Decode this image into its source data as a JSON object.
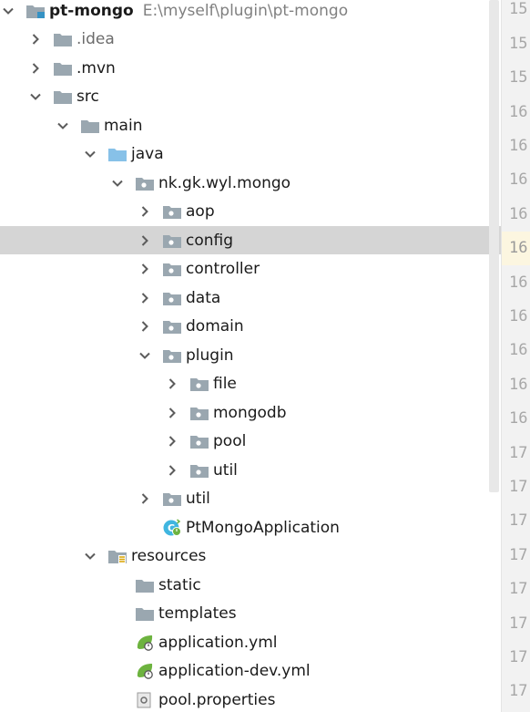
{
  "project": {
    "name": "pt-mongo",
    "path": "E:\\myself\\plugin\\pt-mongo"
  },
  "tree": [
    {
      "label": "pt-mongo",
      "depth": 0,
      "state": "open",
      "icon": "module-folder-icon",
      "bold": true
    },
    {
      "label": ".idea",
      "depth": 1,
      "state": "closed",
      "icon": "folder-icon",
      "dim": true
    },
    {
      "label": ".mvn",
      "depth": 1,
      "state": "closed",
      "icon": "folder-icon"
    },
    {
      "label": "src",
      "depth": 1,
      "state": "open",
      "icon": "folder-icon"
    },
    {
      "label": "main",
      "depth": 2,
      "state": "open",
      "icon": "folder-icon"
    },
    {
      "label": "java",
      "depth": 3,
      "state": "open",
      "icon": "source-root-folder-icon"
    },
    {
      "label": "nk.gk.wyl.mongo",
      "depth": 4,
      "state": "open",
      "icon": "package-icon"
    },
    {
      "label": "aop",
      "depth": 5,
      "state": "closed",
      "icon": "package-icon"
    },
    {
      "label": "config",
      "depth": 5,
      "state": "closed",
      "icon": "package-icon",
      "selected": true
    },
    {
      "label": "controller",
      "depth": 5,
      "state": "closed",
      "icon": "package-icon"
    },
    {
      "label": "data",
      "depth": 5,
      "state": "closed",
      "icon": "package-icon"
    },
    {
      "label": "domain",
      "depth": 5,
      "state": "closed",
      "icon": "package-icon"
    },
    {
      "label": "plugin",
      "depth": 5,
      "state": "open",
      "icon": "package-icon"
    },
    {
      "label": "file",
      "depth": 6,
      "state": "closed",
      "icon": "package-icon"
    },
    {
      "label": "mongodb",
      "depth": 6,
      "state": "closed",
      "icon": "package-icon"
    },
    {
      "label": "pool",
      "depth": 6,
      "state": "closed",
      "icon": "package-icon"
    },
    {
      "label": "util",
      "depth": 6,
      "state": "closed",
      "icon": "package-icon"
    },
    {
      "label": "util",
      "depth": 5,
      "state": "closed",
      "icon": "package-icon"
    },
    {
      "label": "PtMongoApplication",
      "depth": 5,
      "state": "none",
      "icon": "spring-boot-class-icon"
    },
    {
      "label": "resources",
      "depth": 3,
      "state": "open",
      "icon": "resources-root-folder-icon"
    },
    {
      "label": "static",
      "depth": 4,
      "state": "none",
      "icon": "folder-icon"
    },
    {
      "label": "templates",
      "depth": 4,
      "state": "none",
      "icon": "folder-icon"
    },
    {
      "label": "application.yml",
      "depth": 4,
      "state": "none",
      "icon": "spring-yml-icon"
    },
    {
      "label": "application-dev.yml",
      "depth": 4,
      "state": "none",
      "icon": "spring-yml-icon"
    },
    {
      "label": "pool.properties",
      "depth": 4,
      "state": "none",
      "icon": "properties-file-icon"
    }
  ],
  "gutter": [
    "15",
    "15",
    "15",
    "16",
    "16",
    "16",
    "16",
    "16",
    "16",
    "16",
    "16",
    "16",
    "16",
    "17",
    "17",
    "17",
    "17",
    "17",
    "17",
    "17",
    "17"
  ],
  "gutter_current_index": 7,
  "colors": {
    "selection": "#d5d5d5",
    "folder": "#9aa7b0",
    "source_root": "#87c1e8",
    "spring": "#6db33f",
    "gutter_current": "#fcf6e0"
  }
}
